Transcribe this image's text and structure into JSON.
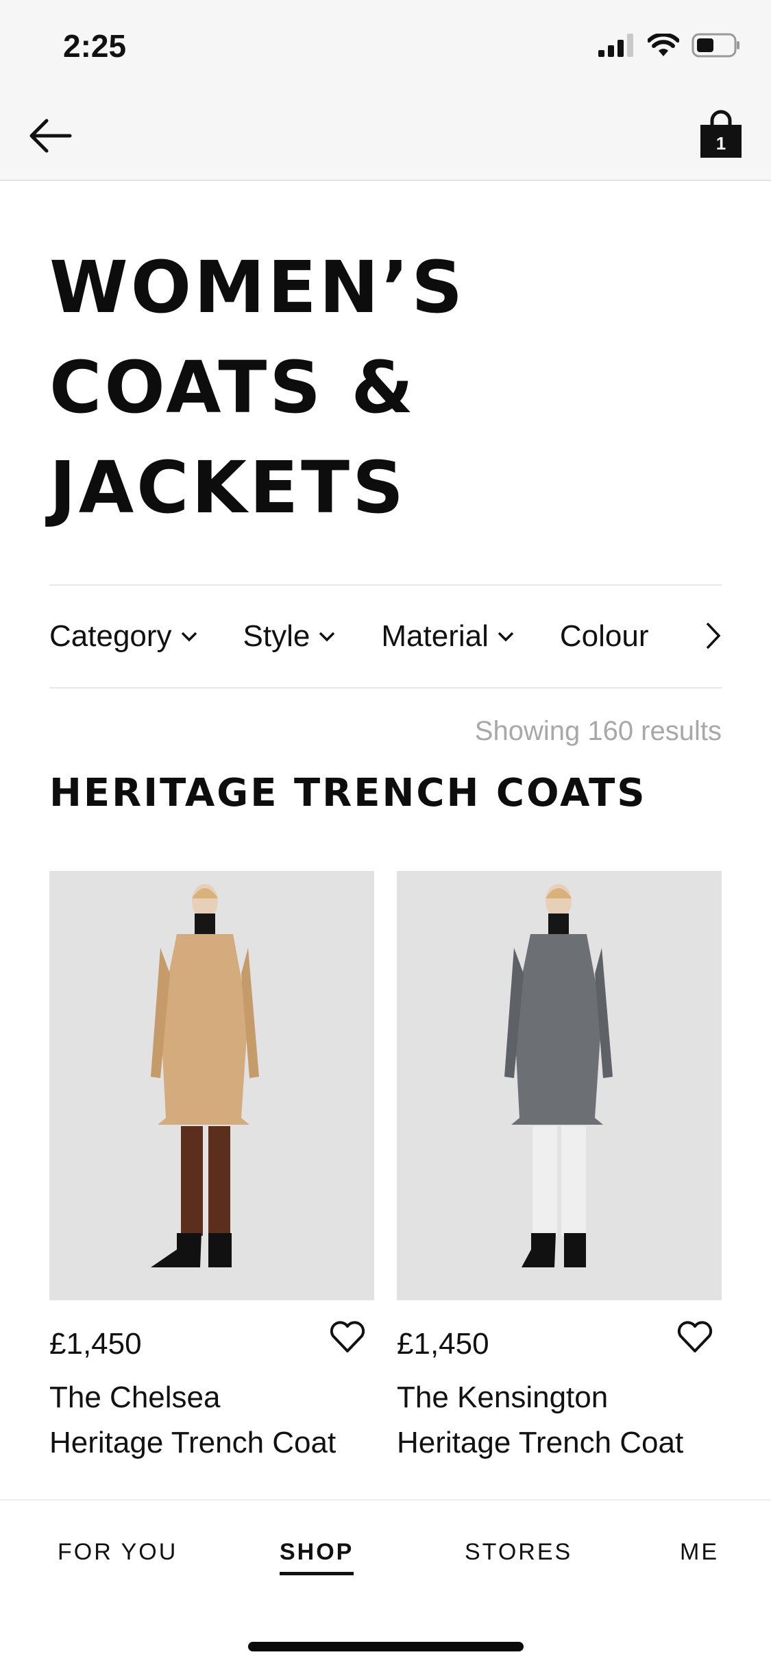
{
  "status": {
    "time": "2:25"
  },
  "nav": {
    "bag_count": "1"
  },
  "page": {
    "title_lines": [
      "WOMEN’S",
      "COATS &",
      "JACKETS"
    ]
  },
  "filters": [
    "Category",
    "Style",
    "Material",
    "Colour"
  ],
  "results": {
    "text": "Showing 160 results"
  },
  "section": {
    "title": "HERITAGE TRENCH COATS"
  },
  "products": [
    {
      "price": "£1,450",
      "name": "The Chelsea Heritage Trench Coat",
      "coat_color": "#d4ab7c"
    },
    {
      "price": "£1,450",
      "name": "The Kensington Heritage Trench Coat",
      "coat_color": "#6c6f74"
    }
  ],
  "tabs": [
    "FOR YOU",
    "SHOP",
    "STORES",
    "ME"
  ],
  "active_tab": "SHOP"
}
